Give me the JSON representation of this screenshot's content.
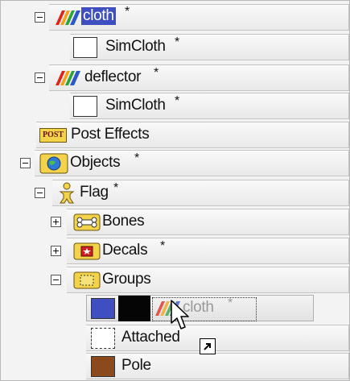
{
  "tree": {
    "cloth_label": "cloth",
    "cloth_flag": "*",
    "cloth_simcloth_label": "SimCloth",
    "cloth_simcloth_flag": "*",
    "deflector_label": "deflector",
    "deflector_flag": "*",
    "deflector_simcloth_label": "SimCloth",
    "deflector_simcloth_flag": "*",
    "posteffects_icon_text": "POST",
    "posteffects_label": "Post Effects",
    "objects_label": "Objects",
    "objects_flag": "*",
    "flag_label": "Flag",
    "flag_flag": "*",
    "bones_label": "Bones",
    "decals_label": "Decals",
    "decals_flag": "*",
    "groups_label": "Groups",
    "drag_label": "cloth",
    "drag_flag": "*",
    "attached_label": "Attached",
    "pole_label": "Pole"
  },
  "colors": {
    "drag_swatch": "#3f4fbf",
    "pole_swatch": "#8b4a1c"
  },
  "icons": {
    "material": "rainbow-material-icon",
    "post": "post-effects-icon",
    "objects": "objects-globe-icon",
    "figure": "figure-icon",
    "bones": "bones-icon",
    "decals": "decals-icon",
    "groups": "groups-icon",
    "cursor": "arrow-cursor-icon",
    "shortcut": "shortcut-arrow-icon"
  }
}
